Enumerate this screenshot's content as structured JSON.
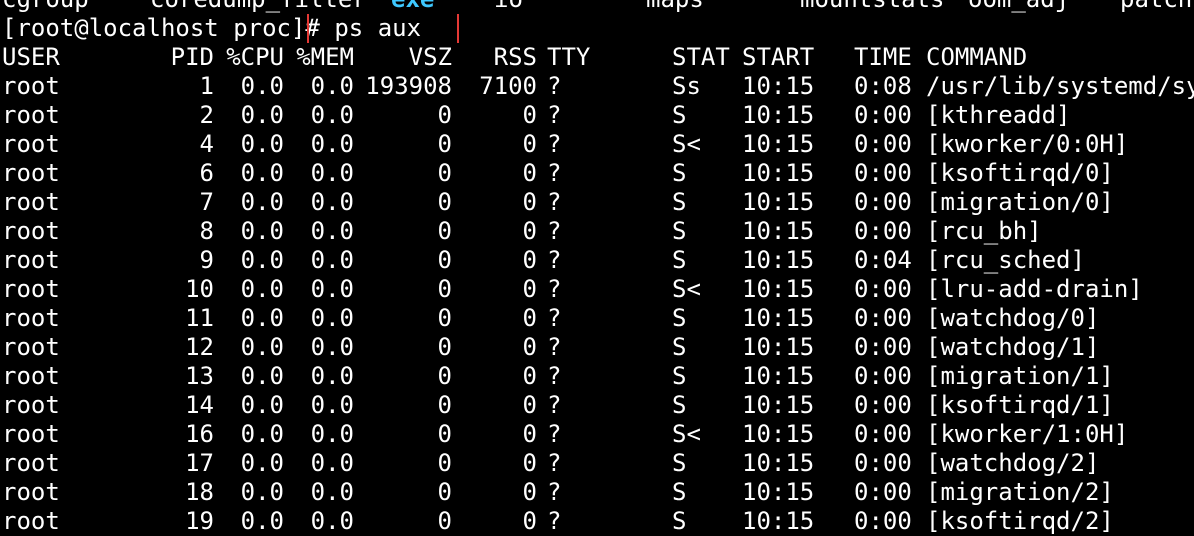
{
  "terminal": {
    "previous_output": {
      "c1": "cgroup",
      "c2": "coredump_filter",
      "c3": "exe",
      "c4": "io",
      "c5": "maps",
      "c6": "mountstats",
      "c7": "oom_adj",
      "c8": "patch"
    },
    "prompt": "[root@localhost proc]#",
    "command": "ps aux",
    "highlight_color": "#e53935",
    "exe_color": "#3ec8ff"
  },
  "ps_table": {
    "headers": {
      "user": "USER",
      "pid": "PID",
      "cpu": "%CPU",
      "mem": "%MEM",
      "vsz": "VSZ",
      "rss": "RSS",
      "tty": "TTY",
      "stat": "STAT",
      "start": "START",
      "time": "TIME",
      "command": "COMMAND"
    },
    "rows": [
      {
        "user": "root",
        "pid": "1",
        "cpu": "0.0",
        "mem": "0.0",
        "vsz": "193908",
        "rss": "7100",
        "tty": "?",
        "stat": "Ss",
        "start": "10:15",
        "time": "0:08",
        "command": "/usr/lib/systemd/sys"
      },
      {
        "user": "root",
        "pid": "2",
        "cpu": "0.0",
        "mem": "0.0",
        "vsz": "0",
        "rss": "0",
        "tty": "?",
        "stat": "S",
        "start": "10:15",
        "time": "0:00",
        "command": "[kthreadd]"
      },
      {
        "user": "root",
        "pid": "4",
        "cpu": "0.0",
        "mem": "0.0",
        "vsz": "0",
        "rss": "0",
        "tty": "?",
        "stat": "S<",
        "start": "10:15",
        "time": "0:00",
        "command": "[kworker/0:0H]"
      },
      {
        "user": "root",
        "pid": "6",
        "cpu": "0.0",
        "mem": "0.0",
        "vsz": "0",
        "rss": "0",
        "tty": "?",
        "stat": "S",
        "start": "10:15",
        "time": "0:00",
        "command": "[ksoftirqd/0]"
      },
      {
        "user": "root",
        "pid": "7",
        "cpu": "0.0",
        "mem": "0.0",
        "vsz": "0",
        "rss": "0",
        "tty": "?",
        "stat": "S",
        "start": "10:15",
        "time": "0:00",
        "command": "[migration/0]"
      },
      {
        "user": "root",
        "pid": "8",
        "cpu": "0.0",
        "mem": "0.0",
        "vsz": "0",
        "rss": "0",
        "tty": "?",
        "stat": "S",
        "start": "10:15",
        "time": "0:00",
        "command": "[rcu_bh]"
      },
      {
        "user": "root",
        "pid": "9",
        "cpu": "0.0",
        "mem": "0.0",
        "vsz": "0",
        "rss": "0",
        "tty": "?",
        "stat": "S",
        "start": "10:15",
        "time": "0:04",
        "command": "[rcu_sched]"
      },
      {
        "user": "root",
        "pid": "10",
        "cpu": "0.0",
        "mem": "0.0",
        "vsz": "0",
        "rss": "0",
        "tty": "?",
        "stat": "S<",
        "start": "10:15",
        "time": "0:00",
        "command": "[lru-add-drain]"
      },
      {
        "user": "root",
        "pid": "11",
        "cpu": "0.0",
        "mem": "0.0",
        "vsz": "0",
        "rss": "0",
        "tty": "?",
        "stat": "S",
        "start": "10:15",
        "time": "0:00",
        "command": "[watchdog/0]"
      },
      {
        "user": "root",
        "pid": "12",
        "cpu": "0.0",
        "mem": "0.0",
        "vsz": "0",
        "rss": "0",
        "tty": "?",
        "stat": "S",
        "start": "10:15",
        "time": "0:00",
        "command": "[watchdog/1]"
      },
      {
        "user": "root",
        "pid": "13",
        "cpu": "0.0",
        "mem": "0.0",
        "vsz": "0",
        "rss": "0",
        "tty": "?",
        "stat": "S",
        "start": "10:15",
        "time": "0:00",
        "command": "[migration/1]"
      },
      {
        "user": "root",
        "pid": "14",
        "cpu": "0.0",
        "mem": "0.0",
        "vsz": "0",
        "rss": "0",
        "tty": "?",
        "stat": "S",
        "start": "10:15",
        "time": "0:00",
        "command": "[ksoftirqd/1]"
      },
      {
        "user": "root",
        "pid": "16",
        "cpu": "0.0",
        "mem": "0.0",
        "vsz": "0",
        "rss": "0",
        "tty": "?",
        "stat": "S<",
        "start": "10:15",
        "time": "0:00",
        "command": "[kworker/1:0H]"
      },
      {
        "user": "root",
        "pid": "17",
        "cpu": "0.0",
        "mem": "0.0",
        "vsz": "0",
        "rss": "0",
        "tty": "?",
        "stat": "S",
        "start": "10:15",
        "time": "0:00",
        "command": "[watchdog/2]"
      },
      {
        "user": "root",
        "pid": "18",
        "cpu": "0.0",
        "mem": "0.0",
        "vsz": "0",
        "rss": "0",
        "tty": "?",
        "stat": "S",
        "start": "10:15",
        "time": "0:00",
        "command": "[migration/2]"
      },
      {
        "user": "root",
        "pid": "19",
        "cpu": "0.0",
        "mem": "0.0",
        "vsz": "0",
        "rss": "0",
        "tty": "?",
        "stat": "S",
        "start": "10:15",
        "time": "0:00",
        "command": "[ksoftirqd/2]"
      }
    ]
  }
}
